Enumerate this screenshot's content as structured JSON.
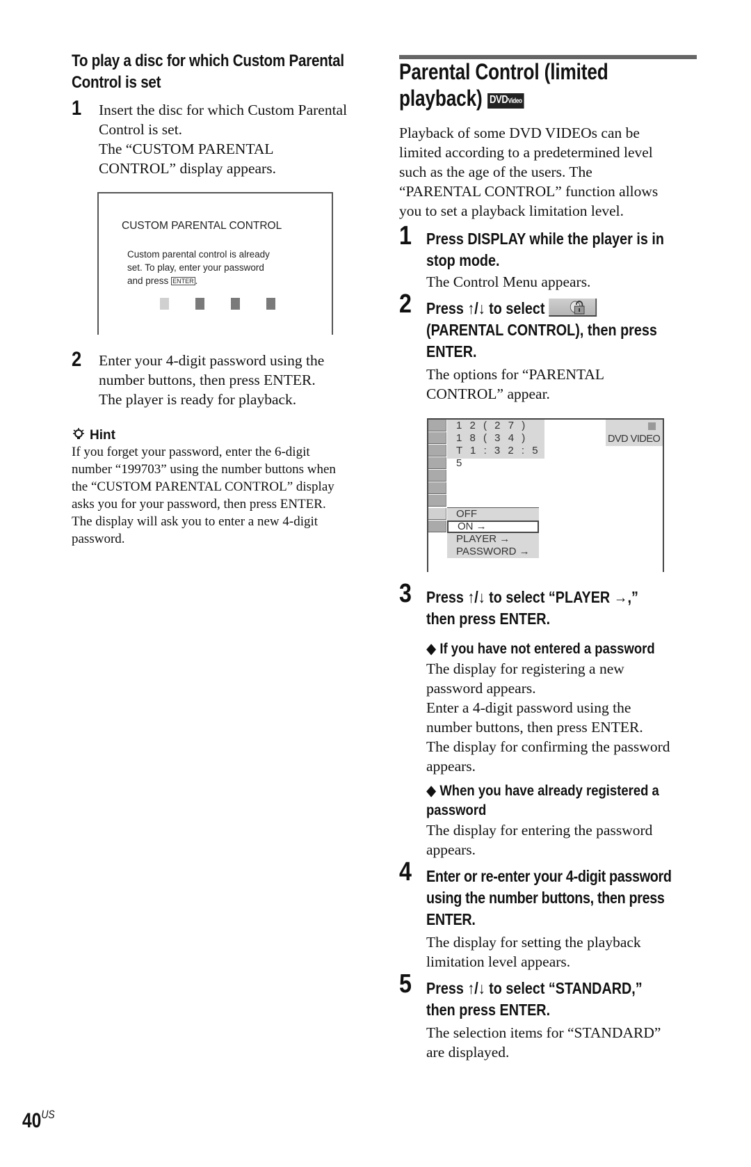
{
  "left_column": {
    "subheading": "To play a disc for which Custom Parental Control is set",
    "steps": [
      {
        "number": "1",
        "lines": [
          "Insert the disc for which Custom Parental",
          "Control is set.",
          "The “CUSTOM PARENTAL",
          "CONTROL” display appears."
        ]
      },
      {
        "number": "2",
        "lines": [
          "Enter your 4-digit password using the",
          "number buttons, then press ENTER.",
          "The player is ready for playback."
        ]
      }
    ],
    "screen": {
      "title": "CUSTOM PARENTAL CONTROL",
      "message_lines": [
        "Custom parental control is already",
        "set. To play, enter your password",
        "and press"
      ],
      "enter_key": "ENTER",
      "enter_suffix": ".",
      "password_boxes": 4,
      "password_filled": 3
    },
    "hint": {
      "icon": "lightbulb-icon",
      "title": "Hint",
      "lines": [
        "If you forget your password, enter the 6-digit",
        "number “199703” using the number buttons when",
        "the “CUSTOM PARENTAL CONTROL” display",
        "asks you for your password, then press ENTER.",
        "The display will ask you to enter a new 4-digit",
        "password."
      ]
    }
  },
  "right_column": {
    "title_line1": "Parental Control (limited",
    "title_line2": "playback)",
    "badge": {
      "main": "DVD",
      "small": "Video"
    },
    "intro_lines": [
      "Playback of some DVD VIDEOs can be",
      "limited according to a predetermined level",
      "such as the age of the users. The",
      "“PARENTAL CONTROL” function allows",
      "you to set a playback limitation level."
    ],
    "steps": [
      {
        "number": "1",
        "heading_lines": [
          "Press DISPLAY while the player is in",
          "stop mode."
        ],
        "body_lines": [
          "The Control Menu appears."
        ]
      },
      {
        "number": "2",
        "heading_lines": [
          "Press ↑/↓ to select",
          "(PARENTAL CONTROL), then press",
          "ENTER."
        ],
        "body_lines": [
          "The options for “PARENTAL",
          "CONTROL” appear."
        ]
      },
      {
        "number": "3",
        "heading_lines": [
          "Press ↑/↓ to select “PLAYER →,”",
          "then press ENTER."
        ],
        "subsections": [
          {
            "heading_lines": [
              "◆ If you have not entered a password"
            ],
            "body_lines": [
              "The display for registering a new",
              "password appears.",
              "Enter a 4-digit password using the",
              "number buttons, then press ENTER.",
              "The display for confirming the password",
              "appears."
            ]
          },
          {
            "heading_lines": [
              "◆ When you have already registered a",
              "password"
            ],
            "body_lines": [
              "The display for entering the password",
              "appears."
            ]
          }
        ]
      },
      {
        "number": "4",
        "heading_lines": [
          "Enter or re-enter your 4-digit password",
          "using the number buttons, then press",
          "ENTER."
        ],
        "body_lines": [
          "The display for setting the playback",
          "limitation level appears."
        ]
      },
      {
        "number": "5",
        "heading_lines": [
          "Press ↑/↓ to select “STANDARD,”",
          "then press ENTER."
        ],
        "body_lines": [
          "The selection items for “STANDARD”",
          "are displayed."
        ]
      }
    ],
    "osd": {
      "info_lines": [
        "1 2 ( 2 7 )",
        "1 8 ( 3 4 )",
        "T    1 : 3 2 : 5 5"
      ],
      "disc_type": "DVD VIDEO",
      "options": [
        "OFF",
        "ON →",
        "PLAYER →",
        "PASSWORD →"
      ],
      "selected_option": "ON →"
    }
  },
  "footer": {
    "page_number": "40",
    "region": "US"
  }
}
